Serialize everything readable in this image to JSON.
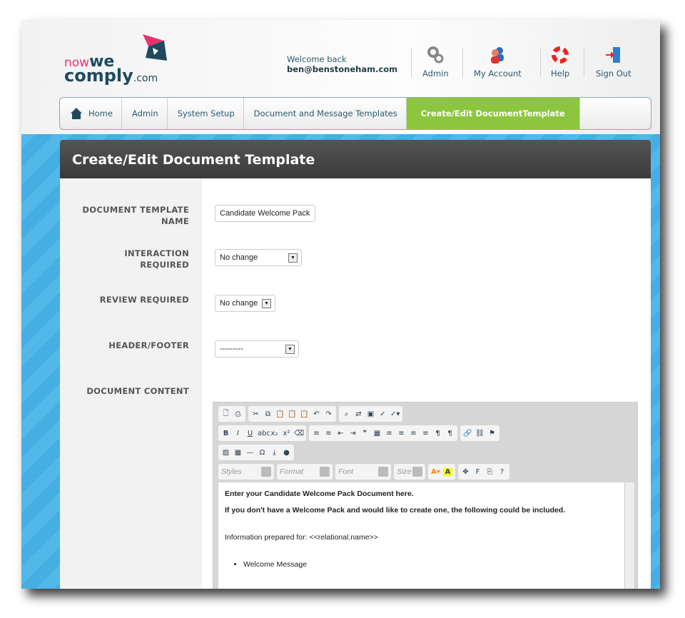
{
  "brand": {
    "now": "now",
    "we": "we",
    "comply": "comply",
    ".com": ".com"
  },
  "header": {
    "welcome": "Welcome back",
    "user": "ben@benstoneham.com",
    "nav": [
      {
        "label": "Admin",
        "icon": "gears-icon"
      },
      {
        "label": "My Account",
        "icon": "users-icon"
      },
      {
        "label": "Help",
        "icon": "lifebuoy-icon"
      },
      {
        "label": "Sign Out",
        "icon": "door-exit-icon"
      }
    ]
  },
  "breadcrumb": [
    "Home",
    "Admin",
    "System Setup",
    "Document and Message Templates",
    "Create/Edit DocumentTemplate"
  ],
  "colors": {
    "accent": "#8cc63f",
    "background": "#4ab3e6",
    "titlebar": "#3f3f3f"
  },
  "page": {
    "title": "Create/Edit Document Template"
  },
  "form": {
    "name_label": "DOCUMENT TEMPLATE NAME",
    "name_value": "Candidate Welcome Pack",
    "interaction_label": "INTERACTION REQUIRED",
    "interaction_value": "No change",
    "review_label": "REVIEW REQUIRED",
    "review_value": "No change",
    "hf_label": "HEADER/FOOTER",
    "hf_value": "---------",
    "content_label": "DOCUMENT CONTENT"
  },
  "editor": {
    "styles": "Styles",
    "format": "Format",
    "font": "Font",
    "size": "Size",
    "content": {
      "p1": "Enter your Candidate Welcome Pack Document here.",
      "p2": "If you don't have a Welcome Pack and would like to create one, the following could be included.",
      "p3": "Information prepared for: <<relational.name>>",
      "li1": "Welcome Message"
    }
  }
}
